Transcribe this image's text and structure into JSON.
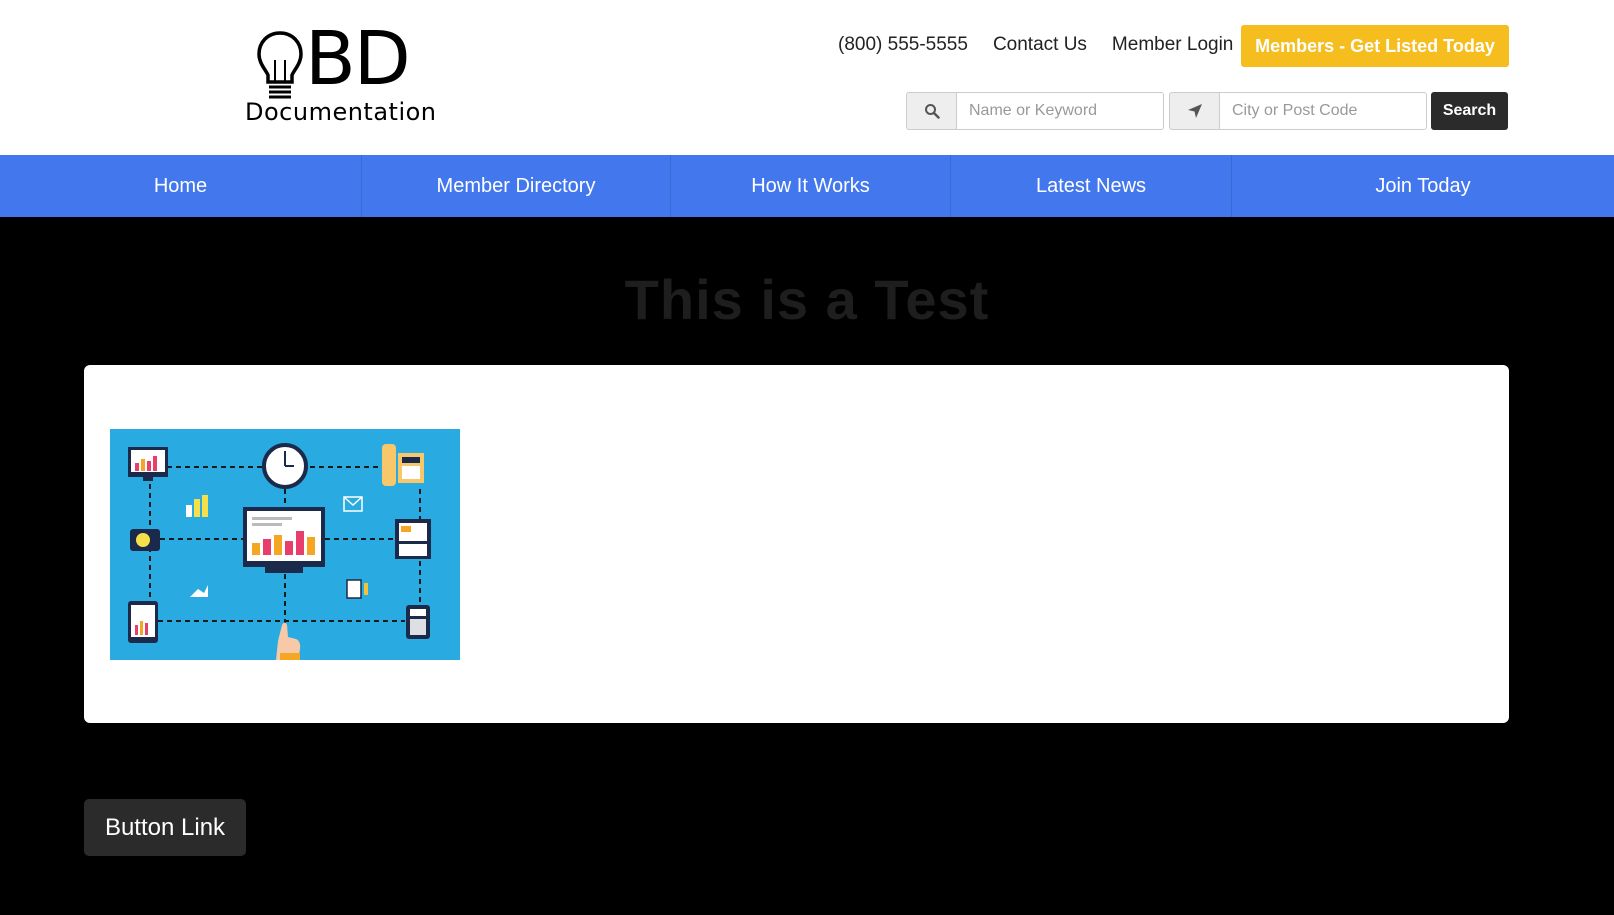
{
  "logo": {
    "mark": "BD",
    "subtitle": "Documentation"
  },
  "header": {
    "phone": "(800) 555-5555",
    "contact": "Contact Us",
    "login": "Member Login",
    "cta": "Members - Get Listed Today",
    "accent": "#f6bd1f"
  },
  "search": {
    "keyword_placeholder": "Name or Keyword",
    "location_placeholder": "City or Post Code",
    "button": "Search",
    "keyword_icon": "search-icon",
    "location_icon": "location-arrow-icon"
  },
  "nav": {
    "color": "#4377ee",
    "items": [
      {
        "label": "Home"
      },
      {
        "label": "Member Directory"
      },
      {
        "label": "How It Works"
      },
      {
        "label": "Latest News"
      },
      {
        "label": "Join Today"
      }
    ]
  },
  "main": {
    "title": "This is a Test",
    "button": "Button Link"
  }
}
